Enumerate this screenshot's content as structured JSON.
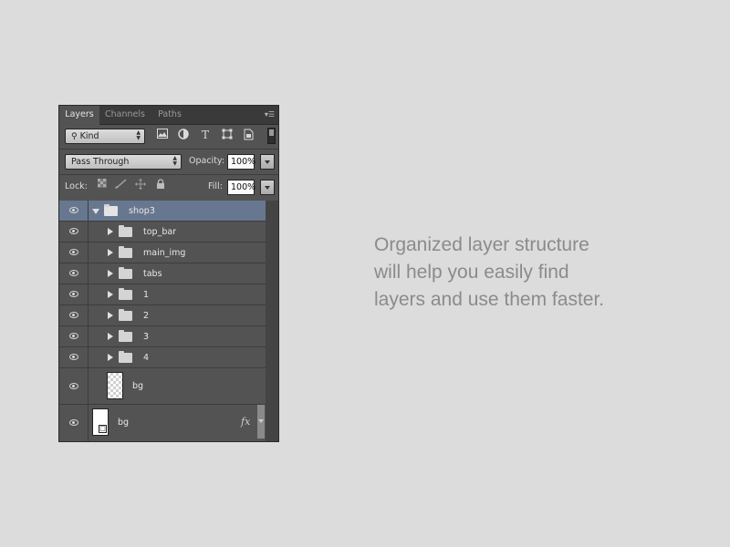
{
  "panel": {
    "tabs": [
      {
        "label": "Layers",
        "active": true
      },
      {
        "label": "Channels",
        "active": false
      },
      {
        "label": "Paths",
        "active": false
      }
    ],
    "menu_icon": "panel-menu-icon"
  },
  "filter": {
    "kind_label": "Kind",
    "icons": [
      "pixel-filter-icon",
      "adjustment-filter-icon",
      "type-filter-icon",
      "shape-filter-icon",
      "smart-object-filter-icon",
      "filter-toggle-switch"
    ]
  },
  "blend": {
    "mode": "Pass Through",
    "opacity_label": "Opacity:",
    "opacity_value": "100%"
  },
  "lock": {
    "label": "Lock:",
    "icons": [
      "lock-transparent-pixels-icon",
      "lock-image-pixels-icon",
      "lock-position-icon",
      "lock-all-icon"
    ],
    "fill_label": "Fill:",
    "fill_value": "100%"
  },
  "layers": [
    {
      "name": "shop3",
      "type": "group",
      "expanded": true,
      "selected": true
    },
    {
      "name": "top_bar",
      "type": "group",
      "expanded": false
    },
    {
      "name": "main_img",
      "type": "group",
      "expanded": false
    },
    {
      "name": "tabs",
      "type": "group",
      "expanded": false
    },
    {
      "name": "1",
      "type": "group",
      "expanded": false
    },
    {
      "name": "2",
      "type": "group",
      "expanded": false
    },
    {
      "name": "3",
      "type": "group",
      "expanded": false
    },
    {
      "name": "4",
      "type": "group",
      "expanded": false
    },
    {
      "name": "bg",
      "type": "pixel",
      "thumbnail": "transparent"
    },
    {
      "name": "bg",
      "type": "pixel",
      "thumbnail": "white",
      "locked": true,
      "fx_label": "fx"
    }
  ],
  "caption": {
    "text": "Organized layer structure\nwill help you easily find\nlayers and use them faster."
  },
  "colors": {
    "background": "#dcdcdc",
    "panel": "#535353",
    "selected_row": "#67778f",
    "caption": "#8b8b8b"
  }
}
